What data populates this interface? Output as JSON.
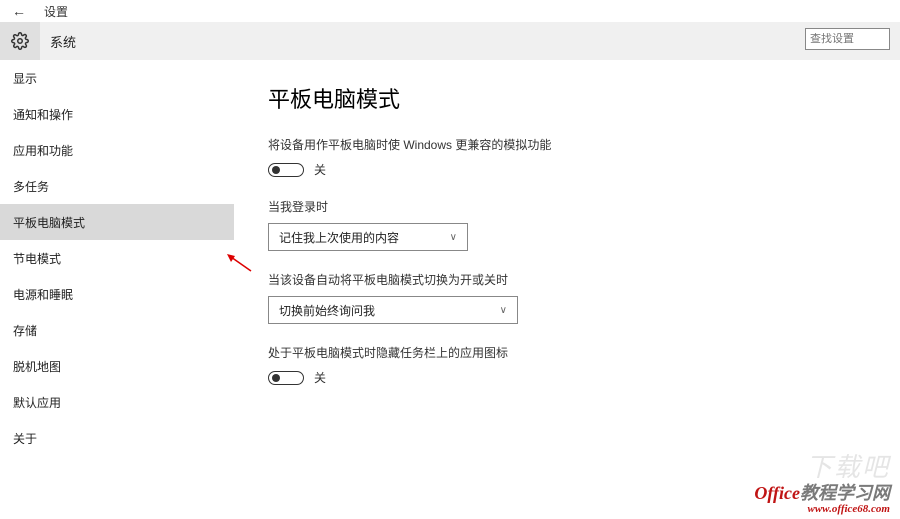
{
  "top": {
    "back": "←",
    "title": "设置"
  },
  "header": {
    "category": "系统"
  },
  "search": {
    "placeholder": "查找设置"
  },
  "sidebar": {
    "items": [
      {
        "label": "显示"
      },
      {
        "label": "通知和操作"
      },
      {
        "label": "应用和功能"
      },
      {
        "label": "多任务"
      },
      {
        "label": "平板电脑模式"
      },
      {
        "label": "节电模式"
      },
      {
        "label": "电源和睡眠"
      },
      {
        "label": "存储"
      },
      {
        "label": "脱机地图"
      },
      {
        "label": "默认应用"
      },
      {
        "label": "关于"
      }
    ],
    "active_index": 4
  },
  "content": {
    "heading": "平板电脑模式",
    "block1": {
      "desc": "将设备用作平板电脑时使 Windows 更兼容的模拟功能",
      "state": "关"
    },
    "block2": {
      "label": "当我登录时",
      "value": "记住我上次使用的内容"
    },
    "block3": {
      "label": "当该设备自动将平板电脑模式切换为开或关时",
      "value": "切换前始终询问我"
    },
    "block4": {
      "desc": "处于平板电脑模式时隐藏任务栏上的应用图标",
      "state": "关"
    }
  },
  "watermark": {
    "big": "下载吧",
    "brand_red": "Office",
    "brand_gray": "教程学习网",
    "url": "www.office68.com"
  }
}
